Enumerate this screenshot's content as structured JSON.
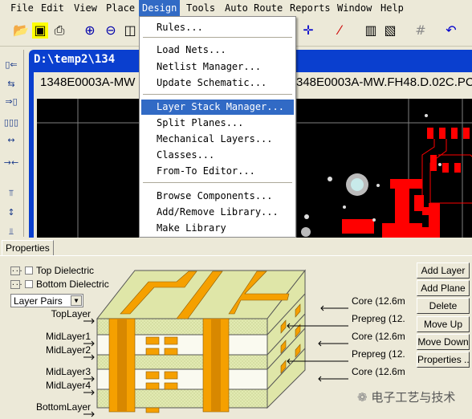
{
  "menubar": {
    "items": [
      "File",
      "Edit",
      "View",
      "Place",
      "Design",
      "Tools",
      "Auto Route",
      "Reports",
      "Window",
      "Help"
    ],
    "active": "Design"
  },
  "toolbar": {
    "icons": [
      "open-folder-icon",
      "save-icon",
      "print-icon",
      "zoom-in-icon",
      "zoom-out-icon",
      "zoom-fit-icon",
      "move-cross-icon",
      "wand-icon",
      "library-icon",
      "browse-library-icon",
      "grid-icon",
      "undo-icon"
    ]
  },
  "document": {
    "title": "D:\\temp2\\134",
    "tabs": [
      "1348E0003A-MW",
      "348E0003A-MW.FH48.D.02C.PC"
    ]
  },
  "design_menu": {
    "items": [
      "Rules...",
      "Load Nets...",
      "Netlist Manager...",
      "Update Schematic...",
      "Layer Stack Manager...",
      "Split Planes...",
      "Mechanical Layers...",
      "Classes...",
      "From-To Editor...",
      "Browse Components...",
      "Add/Remove Library...",
      "Make Library"
    ],
    "highlighted": "Layer Stack Manager..."
  },
  "panel": {
    "tab": "Properties",
    "top_dielectric": {
      "label": "Top Dielectric",
      "checked": false
    },
    "bottom_dielectric": {
      "label": "Bottom Dielectric",
      "checked": false
    },
    "dots_label": "...",
    "layer_mode": "Layer Pairs",
    "layers": [
      "TopLayer",
      "MidLayer1",
      "MidLayer2",
      "MidLayer3",
      "MidLayer4",
      "BottomLayer"
    ],
    "dielectrics": [
      "Core (12.6m",
      "Prepreg (12.",
      "Core (12.6m",
      "Prepreg (12.",
      "Core (12.6m"
    ],
    "buttons": [
      "Add Layer",
      "Add Plane",
      "Delete",
      "Move Up",
      "Move Down",
      "Properties ..."
    ]
  },
  "watermark": "电子工艺与技术",
  "colors": {
    "highlight": "#316ac5",
    "copper": "#f5a000",
    "substrate": "#dfe6a8",
    "pcb_background": "#000000",
    "track": "#ff0000",
    "title_bar": "#0a3fcf"
  }
}
